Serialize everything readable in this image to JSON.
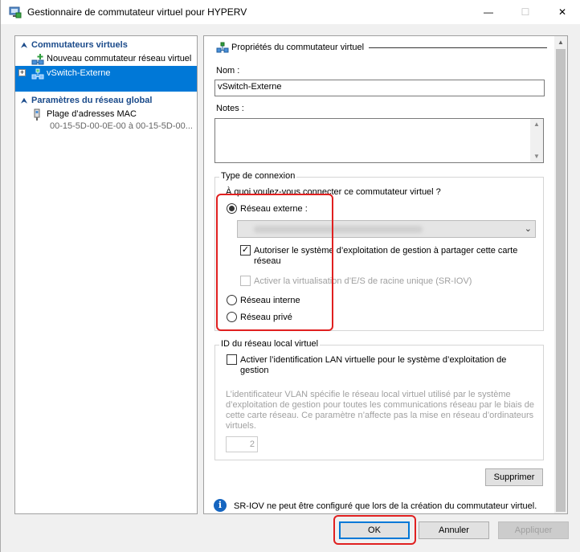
{
  "window": {
    "title": "Gestionnaire de commutateur virtuel pour HYPERV",
    "minimize_glyph": "—",
    "maximize_glyph": "☐",
    "close_glyph": "✕"
  },
  "sidebar": {
    "group1_title": "Commutateurs virtuels",
    "new_switch_label": "Nouveau commutateur réseau virtuel",
    "switch_label": "vSwitch-Externe",
    "group2_title": "Paramètres du réseau global",
    "mac_label": "Plage d’adresses MAC",
    "mac_range": "00-15-5D-00-0E-00 à 00-15-5D-00..."
  },
  "properties": {
    "section_title": "Propriétés du commutateur virtuel",
    "name_label": "Nom :",
    "name_value": "vSwitch-Externe",
    "notes_label": "Notes :",
    "notes_value": ""
  },
  "connection": {
    "group_title": "Type de connexion",
    "question": "À quoi voulez-vous connecter ce commutateur virtuel ?",
    "external_label": "Réseau externe :",
    "allow_mgmt_label_line1": "Autoriser le système d’exploitation de gestion à partager cette carte",
    "allow_mgmt_label_line2": "réseau",
    "sriov_label": "Activer la virtualisation d’E/S de racine unique (SR-IOV)",
    "internal_label": "Réseau interne",
    "private_label": "Réseau privé"
  },
  "vlan": {
    "group_title": "ID du réseau local virtuel",
    "enable_label_line1": "Activer l’identification LAN virtuelle pour le système d’exploitation de",
    "enable_label_line2": "gestion",
    "description": "L’identificateur VLAN spécifie le réseau local virtuel utilisé par le système d’exploitation de gestion pour toutes les communications réseau par le biais de cette carte réseau. Ce paramètre n’affecte pas la mise en réseau d’ordinateurs virtuels.",
    "id_value": "2"
  },
  "delete_label": "Supprimer",
  "info_text": "SR-IOV ne peut être configuré que lors de la création du commutateur virtuel.",
  "buttons": {
    "ok": "OK",
    "cancel": "Annuler",
    "apply": "Appliquer"
  },
  "colors": {
    "selection": "#0078d7",
    "highlight_border": "#e02020",
    "group_header": "#1a4a8a"
  }
}
